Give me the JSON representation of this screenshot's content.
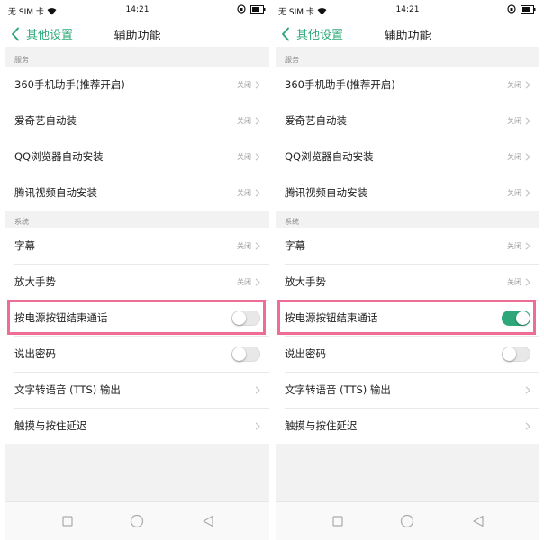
{
  "colors": {
    "accent": "#2ea87a",
    "highlight": "#ee6d95"
  },
  "screens": [
    {
      "status_bar": {
        "carrier": "无 SIM 卡",
        "time": "14:21"
      },
      "nav": {
        "back_label": "其他设置",
        "title": "辅助功能"
      },
      "sections": {
        "service": {
          "header": "服务",
          "items": [
            {
              "label": "360手机助手(推荐开启)",
              "value": "关闭"
            },
            {
              "label": "爱奇艺自动装",
              "value": "关闭"
            },
            {
              "label": "QQ浏览器自动安装",
              "value": "关闭"
            },
            {
              "label": "腾讯视频自动安装",
              "value": "关闭"
            }
          ]
        },
        "system": {
          "header": "系统",
          "items": [
            {
              "label": "字幕",
              "value": "关闭"
            },
            {
              "label": "放大手势",
              "value": "关闭"
            },
            {
              "label": "按电源按钮结束通话",
              "toggle": false
            },
            {
              "label": "说出密码",
              "toggle": false
            },
            {
              "label": "文字转语音 (TTS) 输出"
            },
            {
              "label": "触摸与按住延迟"
            }
          ]
        }
      }
    },
    {
      "status_bar": {
        "carrier": "无 SIM 卡",
        "time": "14:21"
      },
      "nav": {
        "back_label": "其他设置",
        "title": "辅助功能"
      },
      "sections": {
        "service": {
          "header": "服务",
          "items": [
            {
              "label": "360手机助手(推荐开启)",
              "value": "关闭"
            },
            {
              "label": "爱奇艺自动装",
              "value": "关闭"
            },
            {
              "label": "QQ浏览器自动安装",
              "value": "关闭"
            },
            {
              "label": "腾讯视频自动安装",
              "value": "关闭"
            }
          ]
        },
        "system": {
          "header": "系统",
          "items": [
            {
              "label": "字幕",
              "value": "关闭"
            },
            {
              "label": "放大手势",
              "value": "关闭"
            },
            {
              "label": "按电源按钮结束通话",
              "toggle": true
            },
            {
              "label": "说出密码",
              "toggle": false
            },
            {
              "label": "文字转语音 (TTS) 输出"
            },
            {
              "label": "触摸与按住延迟"
            }
          ]
        }
      }
    }
  ]
}
